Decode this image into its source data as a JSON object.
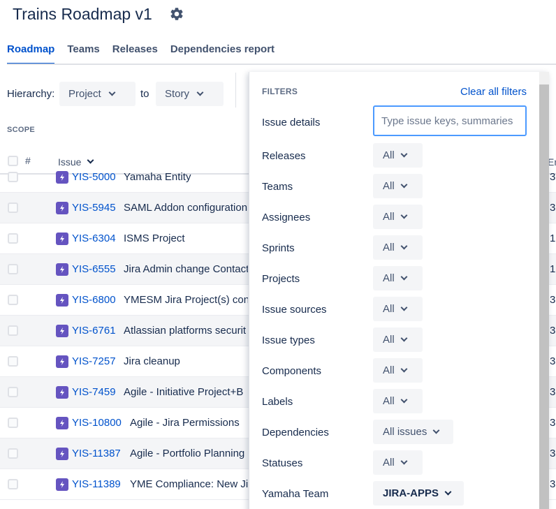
{
  "page": {
    "title": "Trains Roadmap v1"
  },
  "tabs": [
    "Roadmap",
    "Teams",
    "Releases",
    "Dependencies report"
  ],
  "toolbar": {
    "hierarchy_label": "Hierarchy:",
    "from_value": "Project",
    "to_label": "to",
    "to_value": "Story"
  },
  "scope": {
    "label": "SCOPE",
    "hash_header": "#",
    "issue_header": "Issue",
    "right_header": "Er"
  },
  "issues": [
    {
      "key": "YIS-5000",
      "summary": "Yamaha Entity",
      "right": "3"
    },
    {
      "key": "YIS-5945",
      "summary": "SAML Addon configuration",
      "right": "3"
    },
    {
      "key": "YIS-6304",
      "summary": "ISMS Project",
      "right": "1"
    },
    {
      "key": "YIS-6555",
      "summary": "Jira Admin change Contact",
      "right": "1"
    },
    {
      "key": "YIS-6800",
      "summary": "YMESM Jira Project(s) conf",
      "right": "3"
    },
    {
      "key": "YIS-6761",
      "summary": "Atlassian platforms securit",
      "right": "3"
    },
    {
      "key": "YIS-7257",
      "summary": "Jira cleanup",
      "right": "3"
    },
    {
      "key": "YIS-7459",
      "summary": "Agile - Initiative Project+B",
      "right": "3"
    },
    {
      "key": "YIS-10800",
      "summary": "Agile - Jira Permissions",
      "right": "3"
    },
    {
      "key": "YIS-11387",
      "summary": "Agile - Portfolio Planning",
      "right": "3"
    },
    {
      "key": "YIS-11389",
      "summary": "YME Compliance: New Jir",
      "right": "3"
    }
  ],
  "filters": {
    "title": "FILTERS",
    "clear_all": "Clear all filters",
    "issue_details_label": "Issue details",
    "issue_details_placeholder": "Type issue keys, summaries",
    "items": [
      {
        "label": "Releases",
        "value": "All"
      },
      {
        "label": "Teams",
        "value": "All"
      },
      {
        "label": "Assignees",
        "value": "All"
      },
      {
        "label": "Sprints",
        "value": "All"
      },
      {
        "label": "Projects",
        "value": "All"
      },
      {
        "label": "Issue sources",
        "value": "All"
      },
      {
        "label": "Issue types",
        "value": "All"
      },
      {
        "label": "Components",
        "value": "All"
      },
      {
        "label": "Labels",
        "value": "All"
      },
      {
        "label": "Dependencies",
        "value": "All issues"
      },
      {
        "label": "Statuses",
        "value": "All"
      },
      {
        "label": "Yamaha Team",
        "value": "JIRA-APPS"
      }
    ]
  },
  "colors": {
    "accent": "#0052cc",
    "story_icon": "#6554c0",
    "focus_border": "#4c9aff"
  },
  "icons": {
    "settings": "gear-icon",
    "story": "story-icon",
    "dropdown": "chevron-down-icon"
  }
}
